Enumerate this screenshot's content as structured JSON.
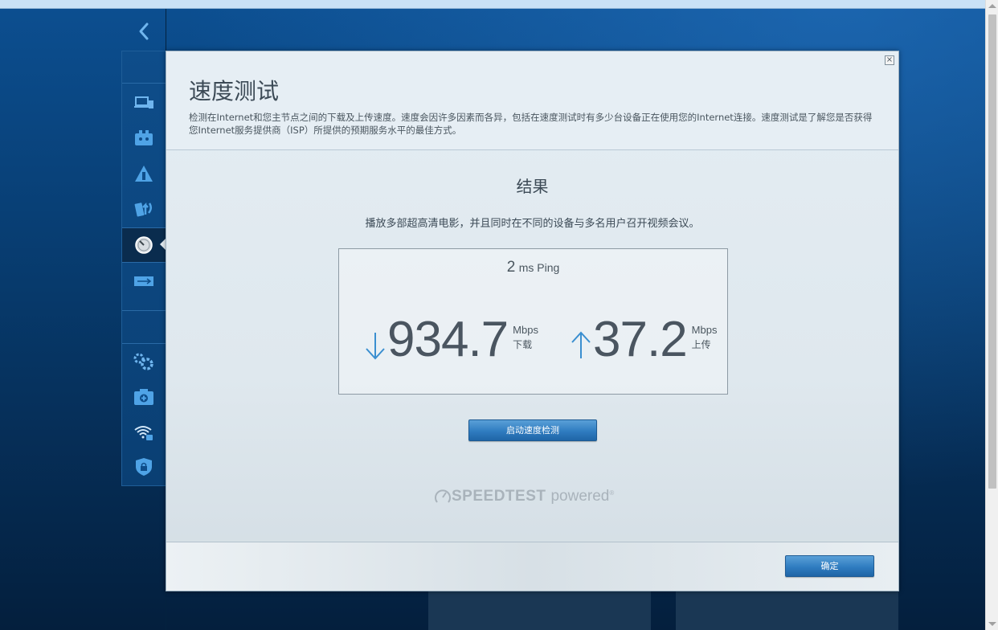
{
  "dialog": {
    "title": "速度测试",
    "description": "检测在Internet和您主节点之间的下载及上传速度。速度会因许多因素而各异，包括在速度测试时有多少台设备正在使用您的Internet连接。速度测试是了解您是否获得您Internet服务提供商（ISP）所提供的预期服务水平的最佳方式。",
    "close_label": "×"
  },
  "result": {
    "title": "结果",
    "description": "播放多部超高清电影，并且同时在不同的设备与多名用户召开视频会议。",
    "ping_value": "2",
    "ping_unit": "ms Ping",
    "download": {
      "value": "934.7",
      "unit": "Mbps",
      "label": "下载"
    },
    "upload": {
      "value": "37.2",
      "unit": "Mbps",
      "label": "上传"
    }
  },
  "buttons": {
    "start_test": "启动速度检测",
    "ok": "确定"
  },
  "branding": {
    "brand": "SPEEDTEST",
    "powered": "powered",
    "mark": "®"
  },
  "colors": {
    "accent": "#2f7cc0",
    "arrow": "#3a8fd0",
    "background": "#0a3f73"
  },
  "sidebar": {
    "icons": [
      "back-chevron-icon",
      "devices-icon",
      "parental-controls-icon",
      "guest-access-icon",
      "priority-icon",
      "speed-test-icon",
      "external-storage-icon",
      "connectivity-icon",
      "troubleshooting-icon",
      "wireless-icon",
      "security-icon"
    ],
    "active": "speed-test-icon"
  }
}
